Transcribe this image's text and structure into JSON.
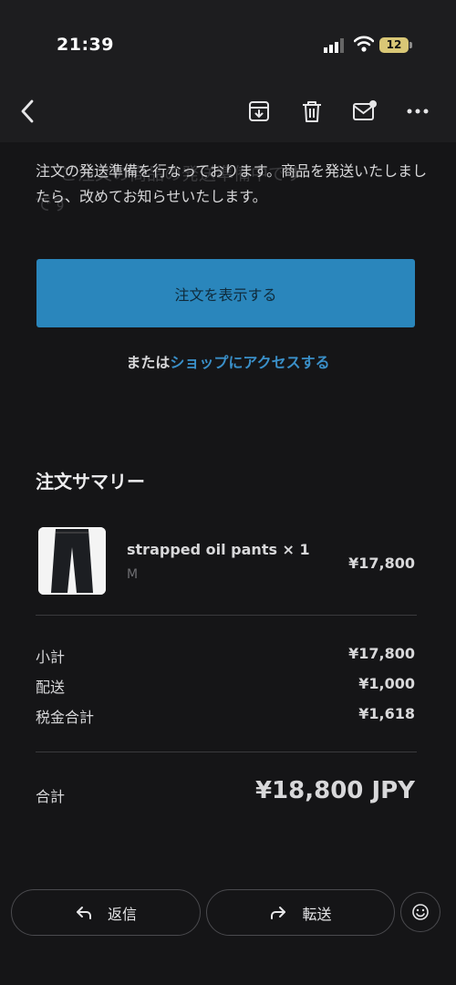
{
  "status_bar": {
    "time": "21:39",
    "battery": "12"
  },
  "nav": {
    "faded_subject_line1": "ご注文の商品の発送準備中です",
    "faded_subject_line2": "です"
  },
  "message": {
    "body": "注文の発送準備を行なっております。商品を発送いたしましたら、改めてお知らせいたします。",
    "view_order_button": "注文を表示する",
    "or_prefix": "または",
    "shop_link": "ショップにアクセスする"
  },
  "summary": {
    "title": "注文サマリー",
    "item": {
      "name": "strapped oil pants × 1",
      "variant": "M",
      "price": "¥17,800"
    },
    "rows": [
      {
        "label": "小計",
        "value": "¥17,800"
      },
      {
        "label": "配送",
        "value": "¥1,000"
      },
      {
        "label": "税金合計",
        "value": "¥1,618"
      }
    ],
    "total_label": "合計",
    "total_value": "¥18,800 JPY"
  },
  "actions": {
    "reply": "返信",
    "forward": "転送"
  },
  "colors": {
    "accent": "#2a86bc",
    "link": "#3a8fc8",
    "background": "#151517"
  }
}
